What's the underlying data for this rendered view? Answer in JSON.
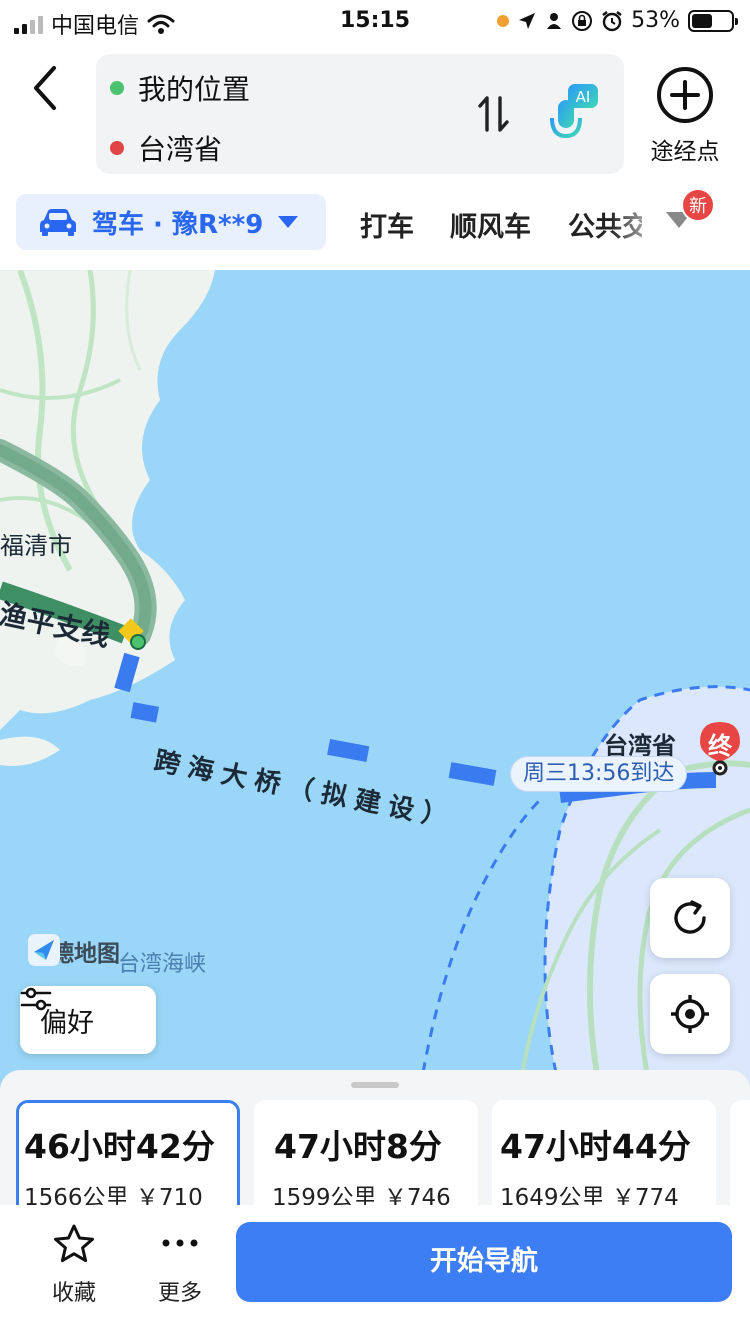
{
  "status_bar": {
    "carrier": "中国电信",
    "time": "15:15",
    "battery": "53%",
    "battery_level": 0.53
  },
  "route": {
    "origin": "我的位置",
    "destination": "台湾省",
    "origin_color": "#4cc26e",
    "destination_color": "#e04646"
  },
  "header": {
    "waypoint_label": "途经点",
    "ai_badge": "AI"
  },
  "modes": {
    "active_label": "驾车 · 豫R**9",
    "tabs": [
      "打车",
      "顺风车",
      "公共交"
    ],
    "new_badge": "新",
    "accent": "#2a67f0"
  },
  "map": {
    "labels": {
      "city": "福清市",
      "road": "渔平支线",
      "bridge": "跨海大桥（拟建设）",
      "destination": "台湾省",
      "strait": "台湾海峡"
    },
    "eta": "周三13:56到达",
    "end_marker": "终",
    "logo": "高德地图",
    "preference_button": "偏好",
    "water_color": "#9ad6f7",
    "route_color": "#3b7bf0"
  },
  "routes": [
    {
      "duration": "46小时42分",
      "distance": "1566公里",
      "cost": "￥710",
      "selected": true
    },
    {
      "duration": "47小时8分",
      "distance": "1599公里",
      "cost": "￥746",
      "selected": false
    },
    {
      "duration": "47小时44分",
      "distance": "1649公里",
      "cost": "￥774",
      "selected": false
    }
  ],
  "actions": {
    "favorite": "收藏",
    "more": "更多",
    "start": "开始导航"
  }
}
